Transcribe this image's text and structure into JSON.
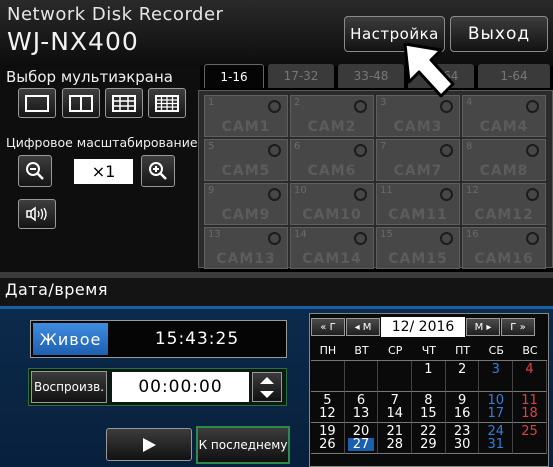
{
  "header": {
    "brand_line1": "Network Disk Recorder",
    "brand_line2": "WJ-NX400",
    "settings_label": "Настройка",
    "exit_label": "Выход"
  },
  "multiscreen": {
    "label": "Выбор мультиэкрана",
    "layouts": [
      "1-screen-layout-icon",
      "2-screen-layout-icon",
      "9-screen-layout-icon",
      "16-screen-layout-icon"
    ]
  },
  "zoom": {
    "label": "Цифровое масштабирование",
    "value": "×1"
  },
  "tabs": [
    {
      "label": "1-16",
      "active": true
    },
    {
      "label": "17-32",
      "active": false
    },
    {
      "label": "33-48",
      "active": false
    },
    {
      "label": "49-64",
      "active": false
    },
    {
      "label": "1-64",
      "active": false
    }
  ],
  "cameras": [
    {
      "num": "1",
      "name": "CAM1"
    },
    {
      "num": "2",
      "name": "CAM2"
    },
    {
      "num": "3",
      "name": "CAM3"
    },
    {
      "num": "4",
      "name": "CAM4"
    },
    {
      "num": "5",
      "name": "CAM5"
    },
    {
      "num": "6",
      "name": "CAM6"
    },
    {
      "num": "7",
      "name": "CAM7"
    },
    {
      "num": "8",
      "name": "CAM8"
    },
    {
      "num": "9",
      "name": "CAM9"
    },
    {
      "num": "10",
      "name": "CAM10"
    },
    {
      "num": "11",
      "name": "CAM11"
    },
    {
      "num": "12",
      "name": "CAM12"
    },
    {
      "num": "13",
      "name": "CAM13"
    },
    {
      "num": "14",
      "name": "CAM14"
    },
    {
      "num": "15",
      "name": "CAM15"
    },
    {
      "num": "16",
      "name": "CAM16"
    }
  ],
  "datetime": {
    "title": "Дата/время",
    "live_label": "Живое",
    "live_time": "15:43:25",
    "playback_label": "Воспроизв.",
    "playback_time": "00:00:00",
    "last_label": "К последнему"
  },
  "calendar": {
    "nav": {
      "prev_year": "« Г",
      "prev_month": "◂ М",
      "month_year": "12/ 2016",
      "next_month": "М ▸",
      "next_year": "Г »"
    },
    "weekdays": [
      "ПН",
      "ВТ",
      "СР",
      "ЧТ",
      "ПТ",
      "СБ",
      "ВС"
    ],
    "rows": [
      [
        {
          "top": "",
          "bottom": ""
        },
        {
          "top": "",
          "bottom": ""
        },
        {
          "top": "",
          "bottom": ""
        },
        {
          "top": "",
          "bottom": "1"
        },
        {
          "top": "",
          "bottom": "2"
        },
        {
          "top": "",
          "bottom": "3"
        },
        {
          "top": "",
          "bottom": "4"
        }
      ],
      [
        {
          "top": "5",
          "bottom": "12"
        },
        {
          "top": "6",
          "bottom": "13"
        },
        {
          "top": "7",
          "bottom": "14"
        },
        {
          "top": "8",
          "bottom": "15"
        },
        {
          "top": "9",
          "bottom": "16"
        },
        {
          "top": "10",
          "bottom": "17"
        },
        {
          "top": "11",
          "bottom": "18"
        }
      ],
      [
        {
          "top": "19",
          "bottom": "26"
        },
        {
          "top": "20",
          "bottom": "27"
        },
        {
          "top": "21",
          "bottom": "28"
        },
        {
          "top": "22",
          "bottom": "29"
        },
        {
          "top": "23",
          "bottom": "30"
        },
        {
          "top": "24",
          "bottom": "31"
        },
        {
          "top": "25",
          "bottom": ""
        }
      ]
    ],
    "selected_day": "27",
    "colors": {
      "saturday": "#2f7fe0",
      "sunday": "#e04040",
      "selected_bg": "#1a5fae"
    }
  },
  "colors": {
    "accent_blue": "#1c5fa8",
    "live_button": "#2f77d0",
    "panel_bg": "#0c2a4c"
  }
}
